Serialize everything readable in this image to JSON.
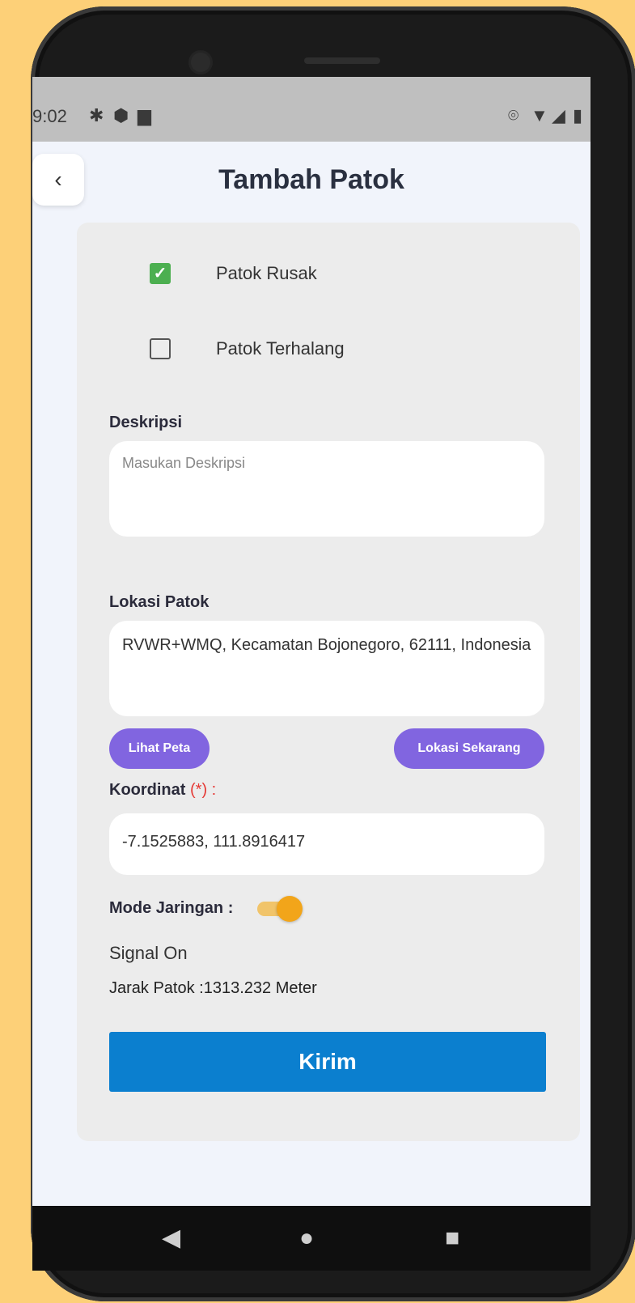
{
  "status_bar": {
    "time": "9:02",
    "left_icons": [
      "gear-icon",
      "shield-icon",
      "sd-card-icon"
    ],
    "right_icons": [
      "location-icon",
      "wifi-icon",
      "signal-icon",
      "battery-icon"
    ]
  },
  "header": {
    "back_icon": "chevron-left-icon",
    "title": "Tambah Patok"
  },
  "form": {
    "checkboxes": [
      {
        "label": "Patok Rusak",
        "checked": true
      },
      {
        "label": "Patok Terhalang",
        "checked": false
      }
    ],
    "description": {
      "label": "Deskripsi",
      "placeholder": "Masukan Deskripsi",
      "value": ""
    },
    "location": {
      "label": "Lokasi Patok",
      "value": "RVWR+WMQ, Kecamatan Bojonegoro, 62111, Indonesia"
    },
    "view_map_button": "Lihat Peta",
    "current_location_button": "Lokasi Sekarang",
    "coordinates": {
      "label": "Koordinat",
      "required_mark": "(*)",
      "suffix": ":",
      "value": "-7.1525883, 111.8916417"
    },
    "network_mode": {
      "label": "Mode Jaringan :",
      "enabled": true
    },
    "signal_status": "Signal On",
    "distance": "Jarak Patok :1313.232 Meter",
    "submit_label": "Kirim"
  },
  "nav_bar": {
    "icons": [
      "back-triangle-icon",
      "home-circle-icon",
      "recents-square-icon"
    ]
  },
  "colors": {
    "page_background": "#fdd078",
    "accent_purple": "#8165e0",
    "submit_blue": "#0b7fcf",
    "checkbox_green": "#4caf50",
    "toggle_orange": "#f2a51a",
    "required_red": "#e53935"
  }
}
